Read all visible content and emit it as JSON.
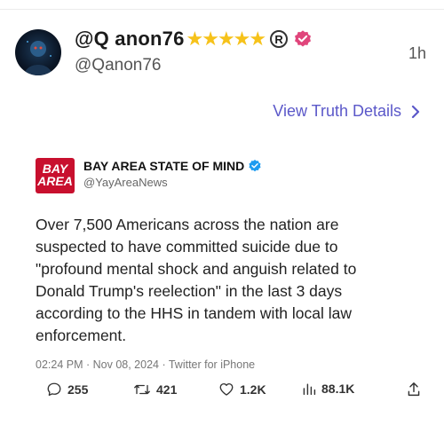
{
  "post": {
    "display_name": "@Q anon76",
    "stars": "★★★★★",
    "registered_mark": "R",
    "handle": "@Qanon76",
    "time": "1h",
    "view_details": "View Truth Details",
    "icons": [
      "avatar",
      "verified-pink-icon",
      "chevron-right-icon"
    ],
    "colors": {
      "stars": "#f6c21a",
      "link": "#5b58c9",
      "verified_pink": "#e0457b"
    }
  },
  "embedded": {
    "logo_text_top": "BAY",
    "logo_text_bottom": "AREA",
    "name": "BAY AREA STATE OF MIND",
    "handle": "@YayAreaNews",
    "text": "Over 7,500 Americans across the nation are\nsuspected to have committed suicide due to\n\"profound mental shock and anguish related to\nDonald Trump's reelection\" in the last 3 days\naccording to the HHS in tandem with local law\nenforcement.",
    "meta": "02:24 PM · Nov 08, 2024 · Twitter for iPhone",
    "stats": {
      "replies": "255",
      "retweets": "421",
      "likes": "1.2K",
      "views": "88.1K"
    },
    "colors": {
      "verified_blue": "#1d9bf0",
      "logo_red": "#c8102e"
    }
  }
}
